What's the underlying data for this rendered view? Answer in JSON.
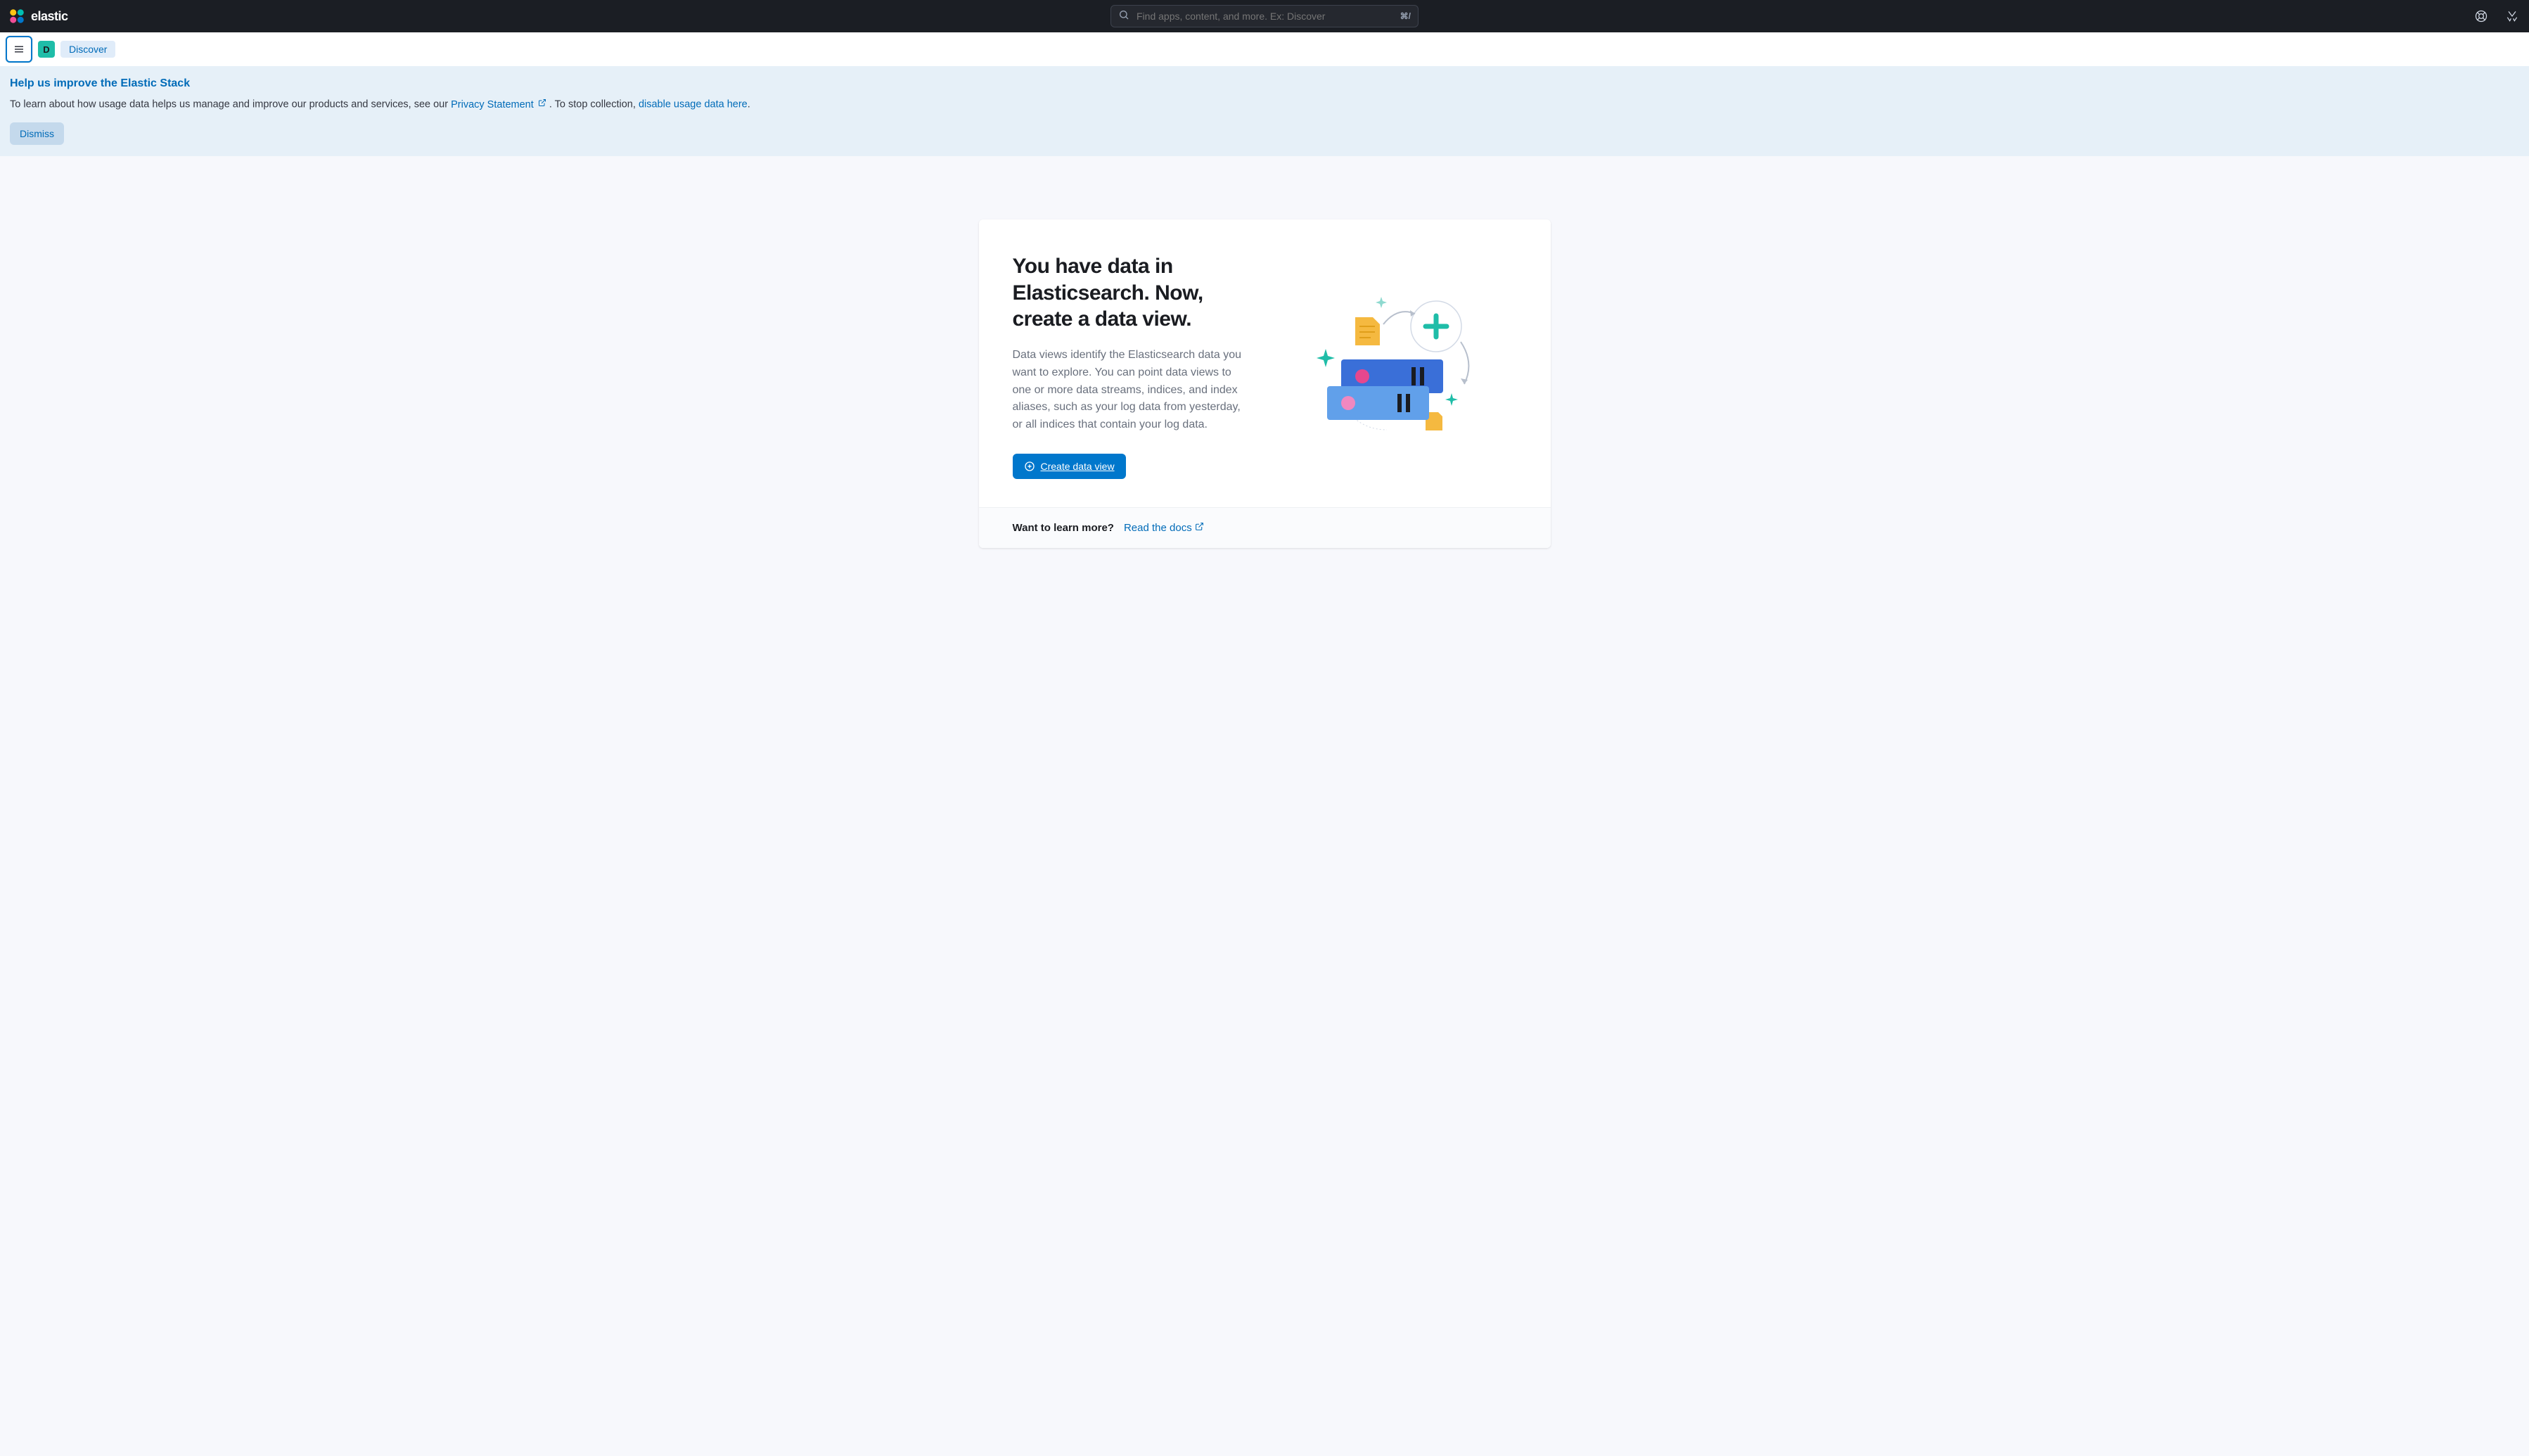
{
  "header": {
    "brand": "elastic",
    "search_placeholder": "Find apps, content, and more. Ex: Discover",
    "search_shortcut": "⌘/"
  },
  "subheader": {
    "space_letter": "D",
    "breadcrumb": "Discover"
  },
  "callout": {
    "title": "Help us improve the Elastic Stack",
    "text_before": "To learn about how usage data helps us manage and improve our products and services, see our ",
    "privacy_link": "Privacy Statement",
    "text_mid": ". To stop collection, ",
    "disable_link": "disable usage data here",
    "text_after": ".",
    "dismiss": "Dismiss"
  },
  "card": {
    "title": "You have data in Elasticsearch. Now, create a data view.",
    "description": "Data views identify the Elasticsearch data you want to explore. You can point data views to one or more data streams, indices, and index aliases, such as your log data from yesterday, or all indices that contain your log data.",
    "create_btn": "Create data view",
    "footer_label": "Want to learn more?",
    "footer_link": "Read the docs"
  }
}
